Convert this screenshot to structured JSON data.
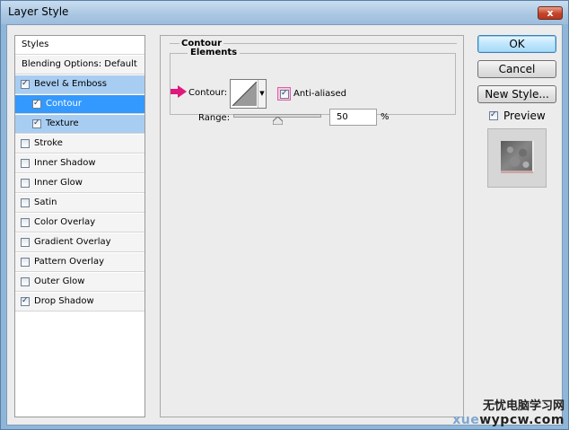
{
  "window": {
    "title": "Layer Style",
    "close_label": "x"
  },
  "styles_panel": {
    "header": "Styles",
    "blending": "Blending Options: Default",
    "items": [
      {
        "label": "Bevel & Emboss",
        "checked": true
      },
      {
        "label": "Contour",
        "checked": true
      },
      {
        "label": "Texture",
        "checked": true
      },
      {
        "label": "Stroke",
        "checked": false
      },
      {
        "label": "Inner Shadow",
        "checked": false
      },
      {
        "label": "Inner Glow",
        "checked": false
      },
      {
        "label": "Satin",
        "checked": false
      },
      {
        "label": "Color Overlay",
        "checked": false
      },
      {
        "label": "Gradient Overlay",
        "checked": false
      },
      {
        "label": "Pattern Overlay",
        "checked": false
      },
      {
        "label": "Outer Glow",
        "checked": false
      },
      {
        "label": "Drop Shadow",
        "checked": true
      }
    ]
  },
  "contour_panel": {
    "section_title": "Contour",
    "group_title": "Elements",
    "contour_label": "Contour:",
    "anti_aliased_label": "Anti-aliased",
    "anti_aliased": true,
    "range_label": "Range:",
    "range_value": "50",
    "range_unit": "%",
    "range_percent": 50
  },
  "buttons": {
    "ok": "OK",
    "cancel": "Cancel",
    "new_style": "New Style..."
  },
  "preview": {
    "label": "Preview",
    "checked": true
  },
  "watermark": {
    "cn": "无忧电脑学习网",
    "url_faint": "xue",
    "url_main": "wypcw.com"
  },
  "colors": {
    "arrow": "#e0187e",
    "selection_dark": "#3399ff",
    "selection_light": "#a8cdf2"
  },
  "icons": {
    "arrow": "pink-arrow-icon",
    "checkbox": "checkmark-icon",
    "slider": "slider-thumb-icon"
  }
}
